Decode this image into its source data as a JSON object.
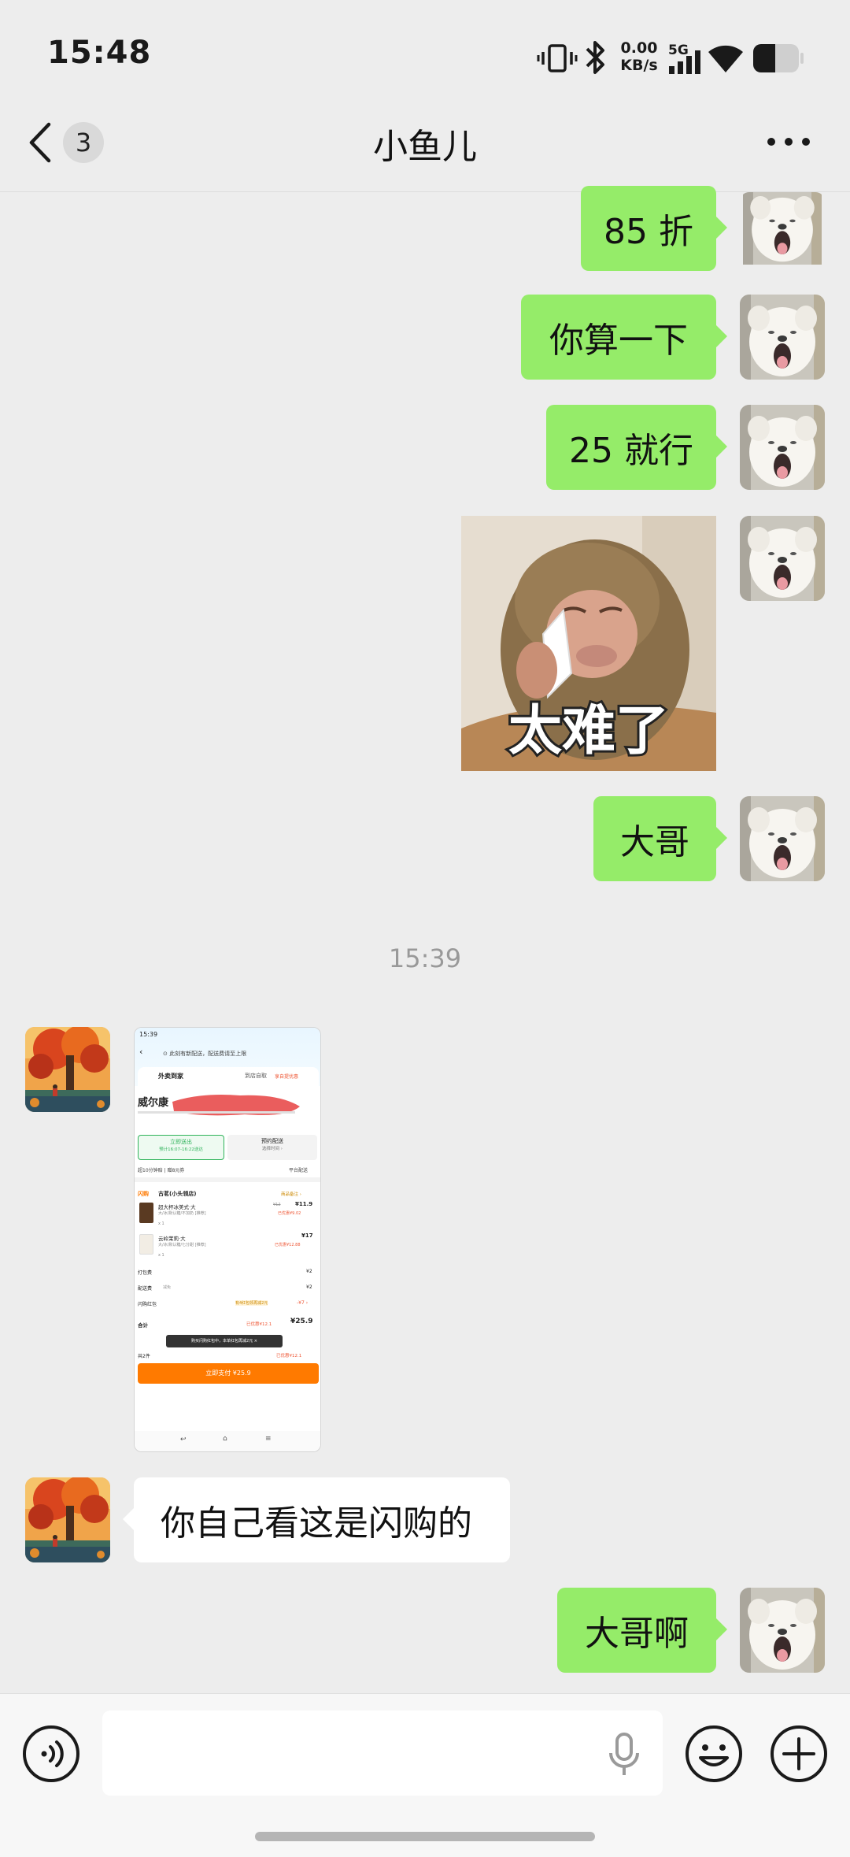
{
  "status_bar": {
    "time": "15:48",
    "net_speed_value": "0.00",
    "net_speed_unit": "KB/s",
    "network": "5G",
    "icons": [
      "vibrate-icon",
      "bluetooth-icon",
      "signal-icon",
      "wifi-icon",
      "battery-icon"
    ]
  },
  "nav": {
    "unread_count": "3",
    "title": "小鱼儿",
    "more_icon": "more-dots-icon"
  },
  "messages": [
    {
      "side": "out",
      "type": "text",
      "text": "85 折"
    },
    {
      "side": "out",
      "type": "text",
      "text": "你算一下"
    },
    {
      "side": "out",
      "type": "text",
      "text": "25 就行"
    },
    {
      "side": "out",
      "type": "sticker",
      "caption": "太难了"
    },
    {
      "side": "out",
      "type": "text",
      "text": "大哥"
    },
    {
      "side": "system",
      "type": "time",
      "text": "15:39"
    },
    {
      "side": "in",
      "type": "screenshot"
    },
    {
      "side": "in",
      "type": "text",
      "text": "你自己看这是闪购的"
    },
    {
      "side": "out",
      "type": "text",
      "text": "大哥啊"
    }
  ],
  "shared_screenshot": {
    "status_time": "15:39",
    "notice": "⊙ 此刻有新配送，配送费请至上限",
    "tab_active": "外卖到家",
    "tab_pickup": "到店自取",
    "tab_tag": "享自提优惠",
    "store_name": "威尔康",
    "option_now": "立即送出",
    "option_now_sub": "预计16:07-16:22送达",
    "option_later": "预约配送",
    "option_later_sub": "选择时间 ›",
    "delivery_note": "超10分钟赔 | 赠8元券",
    "delivery_platform": "平台配送",
    "flash_tag": "闪购",
    "shop_line": "古茗(小头领店)",
    "shop_line_right": "商品备注 ›",
    "item1_name": "超大杯冰美式·大",
    "item1_desc": "大/冰/默认糖/不加奶 [推荐]",
    "item1_price": "¥11.9",
    "item1_price_old": "¥12",
    "item1_discount": "已优惠¥9.02",
    "item1_qty": "x 1",
    "item2_name": "云岭茉莉·大",
    "item2_desc": "大/冰/默认糖/七分甜 [推荐]",
    "item2_price": "¥17",
    "item2_discount": "已优惠¥12.88",
    "item2_qty": "x 1",
    "fee_pack_label": "打包费",
    "fee_pack": "¥2",
    "fee_delivery_label": "配送费",
    "fee_delivery_note": "减免",
    "fee_delivery": "¥2",
    "redpack_label": "闪购红包",
    "redpack_note": "有4红包领再减2元",
    "redpack": "-¥7 ›",
    "total_label": "合计",
    "total_discount": "已优惠¥12.1",
    "total": "¥25.9",
    "toast": "购买闪购红包中，本单红包再减2元 ×",
    "count_label": "共2件",
    "count_discount": "已优惠¥12.1",
    "pay_button": "立即支付 ¥25.9"
  },
  "input_bar": {
    "voice_icon": "voice-toggle-icon",
    "mic_icon": "microphone-icon",
    "emoji_icon": "emoji-icon",
    "add_icon": "plus-icon",
    "placeholder": ""
  },
  "colors": {
    "bubble_out": "#95ec69",
    "bubble_in": "#ffffff",
    "background": "#ededed",
    "pay_orange": "#ff7a00"
  }
}
